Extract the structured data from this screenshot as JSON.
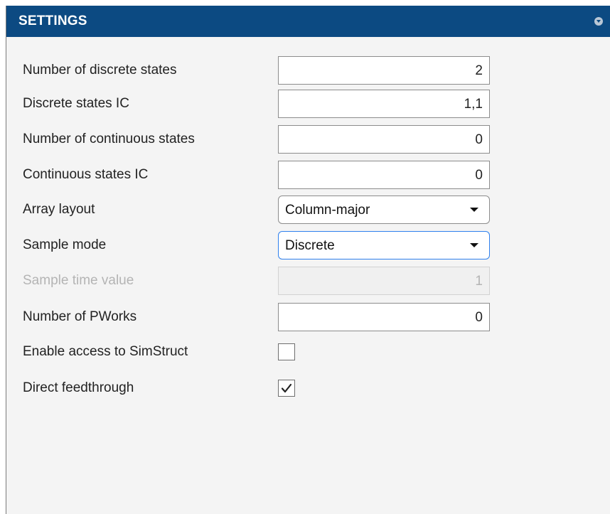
{
  "header": {
    "title": "SETTINGS",
    "collapse_icon": "chevron-down-circle-icon"
  },
  "fields": {
    "discrete_states": {
      "label": "Number of discrete states",
      "value": "2"
    },
    "discrete_ic": {
      "label": "Discrete states IC",
      "value": "1,1"
    },
    "continuous_states": {
      "label": "Number of continuous states",
      "value": "0"
    },
    "continuous_ic": {
      "label": "Continuous states IC",
      "value": "0"
    },
    "array_layout": {
      "label": "Array layout",
      "value": "Column-major"
    },
    "sample_mode": {
      "label": "Sample mode",
      "value": "Discrete"
    },
    "sample_time": {
      "label": "Sample time value",
      "value": "1",
      "disabled": true
    },
    "pworks": {
      "label": "Number of PWorks",
      "value": "0"
    },
    "simstruct": {
      "label": "Enable access to SimStruct",
      "checked": false
    },
    "feedthrough": {
      "label": "Direct feedthrough",
      "checked": true
    }
  },
  "colors": {
    "header_bg": "#0c4a82",
    "panel_bg": "#f4f4f4",
    "focus_border": "#2f80ed",
    "disabled_text": "#b4b4b4"
  }
}
